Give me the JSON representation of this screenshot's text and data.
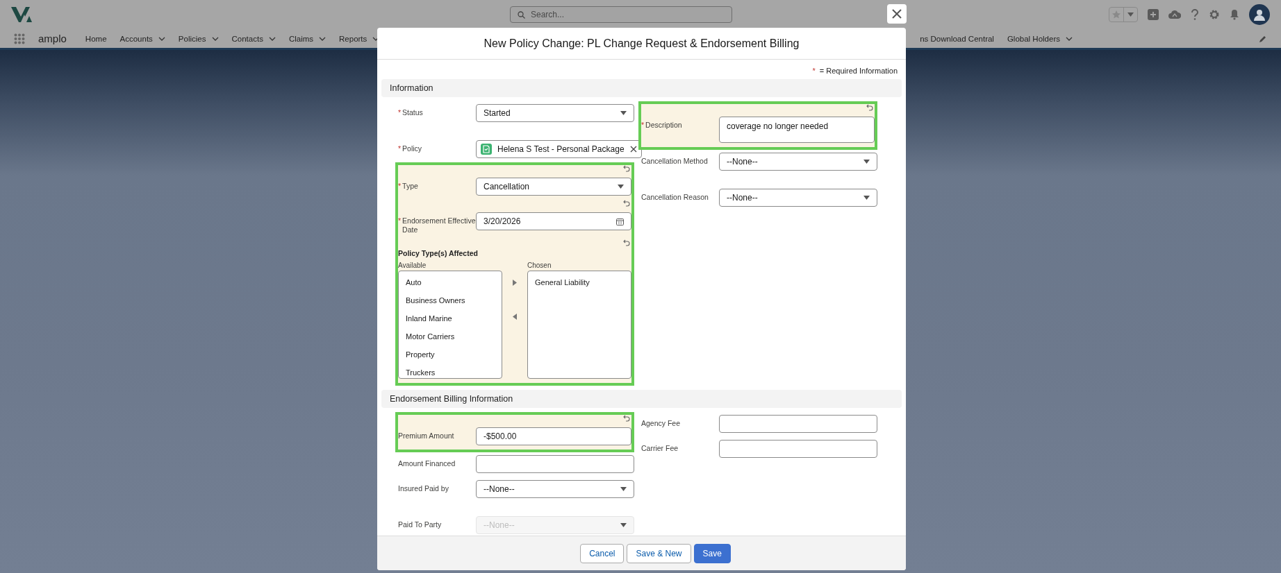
{
  "header": {
    "search_placeholder": "Search...",
    "app_name": "amplo"
  },
  "nav": {
    "left": [
      {
        "label": "Home",
        "menu": false
      },
      {
        "label": "Accounts",
        "menu": true
      },
      {
        "label": "Policies",
        "menu": true
      },
      {
        "label": "Contacts",
        "menu": true
      },
      {
        "label": "Claims",
        "menu": true
      },
      {
        "label": "Reports",
        "menu": true
      }
    ],
    "right": [
      {
        "label": "ns Download Central",
        "menu": false
      },
      {
        "label": "Global Holders",
        "menu": true
      }
    ]
  },
  "modal": {
    "title": "New Policy Change: PL Change Request & Endorsement Billing",
    "required_mark": "*",
    "required_text": "= Required Information",
    "sections": [
      {
        "title": "Information",
        "columns": [
          [
            {
              "kind": "select",
              "label": "Status",
              "required": true,
              "changed": false,
              "disabled": false,
              "value": "Started"
            },
            {
              "kind": "lookup",
              "label": "Policy",
              "required": true,
              "changed": false,
              "disabled": false,
              "value": "Helena S Test - Personal Package"
            },
            {
              "kind": "select",
              "label": "Type",
              "required": true,
              "changed": true,
              "disabled": false,
              "value": "Cancellation"
            },
            {
              "kind": "date",
              "label": "Endorsement Effective Date",
              "required": true,
              "changed": true,
              "disabled": false,
              "value": "3/20/2026"
            },
            {
              "kind": "dual_listbox",
              "label": "Policy Type(s) Affected",
              "required": false,
              "changed": true,
              "disabled": false,
              "available_label": "Available",
              "chosen_label": "Chosen",
              "available": [
                "Auto",
                "Business Owners",
                "Inland Marine",
                "Motor Carriers",
                "Property",
                "Truckers"
              ],
              "chosen": [
                "General Liability"
              ]
            }
          ],
          [
            {
              "kind": "textarea",
              "label": "Description",
              "required": true,
              "changed": true,
              "disabled": false,
              "value": "coverage no longer needed"
            },
            {
              "kind": "select",
              "label": "Cancellation Method",
              "required": false,
              "changed": false,
              "disabled": false,
              "value": "--None--"
            },
            {
              "kind": "select",
              "label": "Cancellation Reason",
              "required": false,
              "changed": false,
              "disabled": false,
              "value": "--None--"
            }
          ]
        ]
      },
      {
        "title": "Endorsement Billing Information",
        "columns": [
          [
            {
              "kind": "text",
              "label": "Premium Amount",
              "required": false,
              "changed": true,
              "disabled": false,
              "value": "-$500.00"
            },
            {
              "kind": "text",
              "label": "Amount Financed",
              "required": false,
              "changed": false,
              "disabled": false
            },
            {
              "kind": "select",
              "label": "Insured Paid by",
              "required": false,
              "changed": false,
              "disabled": false,
              "value": "--None--"
            },
            {
              "kind": "select",
              "label": "Paid To Party",
              "required": false,
              "changed": false,
              "disabled": true,
              "value": "--None--"
            }
          ],
          [
            {
              "kind": "text",
              "label": "Agency Fee",
              "required": false,
              "changed": false,
              "disabled": false
            },
            {
              "kind": "text",
              "label": "Carrier Fee",
              "required": false,
              "changed": false,
              "disabled": false
            }
          ]
        ]
      }
    ],
    "buttons": [
      {
        "label": "Cancel",
        "primary": false
      },
      {
        "label": "Save & New",
        "primary": false
      },
      {
        "label": "Save",
        "primary": true
      }
    ]
  }
}
